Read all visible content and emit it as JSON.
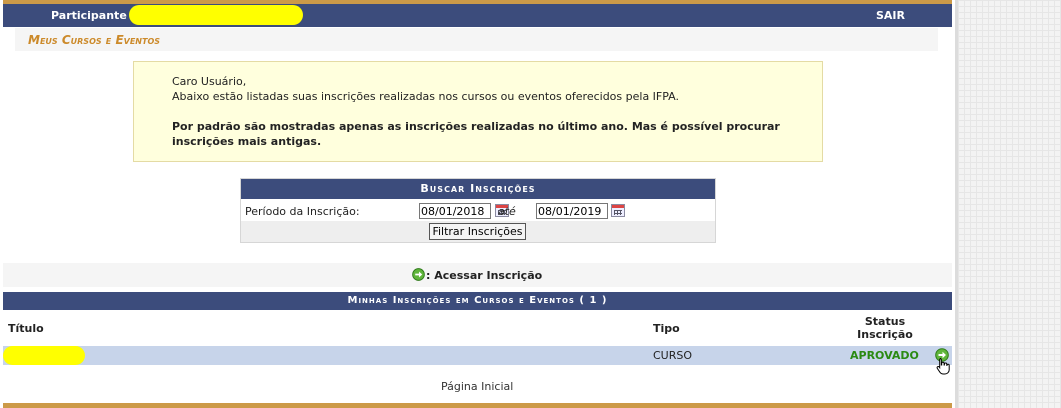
{
  "header": {
    "participant_label": "Participante",
    "logout_label": "SAIR"
  },
  "subheader": {
    "title": "Meus Cursos e Eventos"
  },
  "notice": {
    "greeting": "Caro Usuário,",
    "line1": "Abaixo estão listadas suas inscrições realizadas nos cursos ou eventos oferecidos pela IFPA.",
    "bold_line": "Por padrão são mostradas apenas as inscrições realizadas no último ano. Mas é possível procurar inscrições mais antigas."
  },
  "search": {
    "caption": "Buscar Inscrições",
    "period_label": "Período da Inscrição:",
    "date_from": "08/01/2018",
    "between_label": "até",
    "date_to": "08/01/2019",
    "filter_button": "Filtrar Inscrições"
  },
  "legend": {
    "access_label": ": Acessar Inscrição"
  },
  "results": {
    "caption": "Minhas Inscrições em Cursos e Eventos ( 1 )",
    "columns": {
      "title": "Título",
      "type": "Tipo",
      "status_line1": "Status",
      "status_line2": "Inscrição"
    },
    "rows": [
      {
        "type": "CURSO",
        "status": "APROVADO"
      }
    ]
  },
  "footer": {
    "home_link": "Página Inicial"
  },
  "colors": {
    "header_bg": "#3c4c7c",
    "accent": "#cc9a48",
    "status_green": "#2a8a12",
    "row_bg": "#c7d4ea"
  }
}
